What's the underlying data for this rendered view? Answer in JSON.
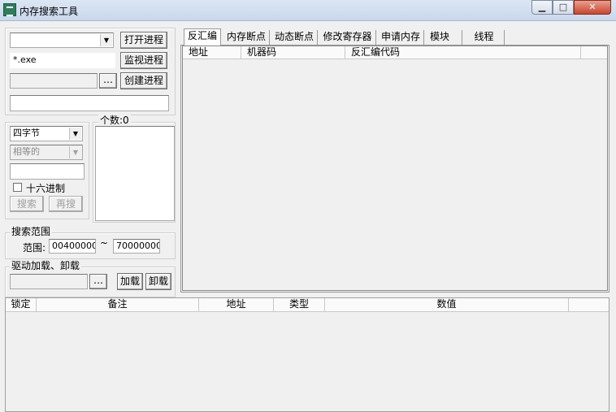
{
  "window": {
    "title": "内存搜索工具",
    "minimize": "▁",
    "maximize": "□",
    "close": "✕",
    "icon": "app-icon"
  },
  "process": {
    "combo_value": "",
    "filter": "*.exe",
    "path": "",
    "browse": "…",
    "open_btn": "打开进程",
    "monitor_btn": "监视进程",
    "create_btn": "创建进程",
    "info": ""
  },
  "search": {
    "size_value": "四字节",
    "compare_value": "相等的",
    "value_input": "",
    "hex_label": "十六进制",
    "hex_checked": false,
    "search_btn": "搜索",
    "research_btn": "再搜",
    "count_label": "个数:0"
  },
  "range": {
    "legend": "搜索范围",
    "label": "范围:",
    "from": "00400000",
    "sep": "~",
    "to": "70000000"
  },
  "driver": {
    "legend": "驱动加载、卸载",
    "path": "",
    "browse": "…",
    "load_btn": "加载",
    "unload_btn": "卸载"
  },
  "tabs": [
    {
      "label": "反汇编",
      "active": true
    },
    {
      "label": "内存断点"
    },
    {
      "label": "动态断点"
    },
    {
      "label": "修改寄存器"
    },
    {
      "label": "申请内存"
    },
    {
      "label": "模块"
    },
    {
      "label": "线程"
    }
  ],
  "disasm_columns": [
    "地址",
    "机器码",
    "反汇编代码"
  ],
  "result_columns": [
    "锁定",
    "备注",
    "地址",
    "类型",
    "数值"
  ]
}
